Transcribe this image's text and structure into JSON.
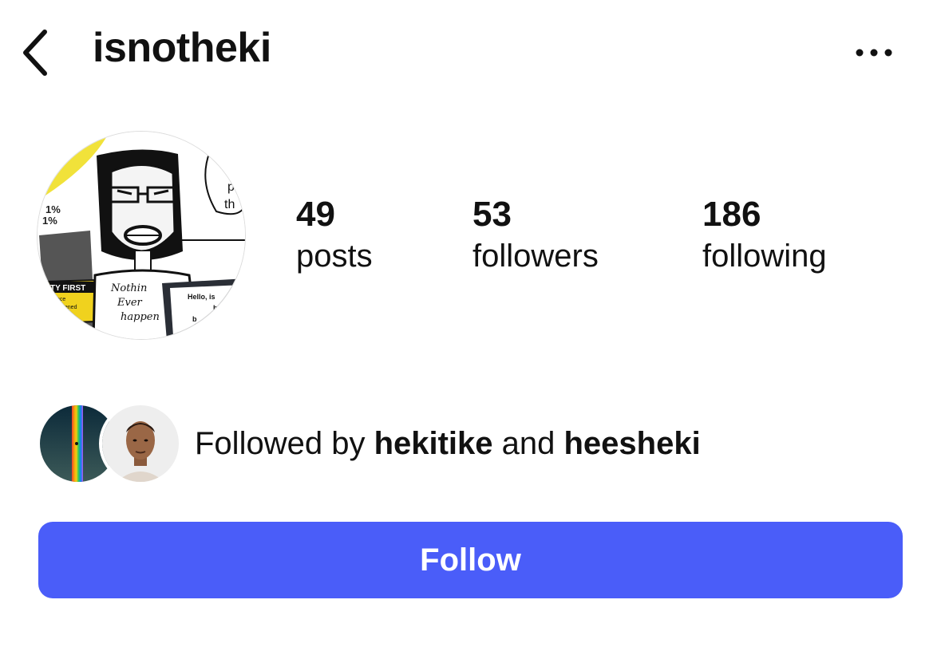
{
  "header": {
    "back_icon": "chevron-left-icon",
    "username": "isnotheki",
    "more_icon": "more-horizontal-icon"
  },
  "profile": {
    "avatar_icon": "profile-picture",
    "avatar_texts": {
      "percent_a": "1%",
      "percent_b": "1%",
      "sign": "TY FIRST",
      "sign_sub1": "nce",
      "sign_sub2": "pened",
      "shirt1": "Nothin",
      "shirt2": "Ever",
      "shirt3": "happen",
      "laptop1": "Hello, is",
      "laptop2": "he",
      "laptop3": "b",
      "bubble1": "p",
      "bubble2": "th"
    }
  },
  "stats": [
    {
      "value": "49",
      "label": "posts"
    },
    {
      "value": "53",
      "label": "followers"
    },
    {
      "value": "186",
      "label": "following"
    }
  ],
  "mutual": {
    "prefix": "Followed by ",
    "user1": "hekitike",
    "connector": " and ",
    "user2": "heesheki",
    "avatar1_icon": "mutual-avatar-rainbow",
    "avatar2_icon": "mutual-avatar-person"
  },
  "follow_button": {
    "label": "Follow",
    "color": "#4a5df9"
  }
}
